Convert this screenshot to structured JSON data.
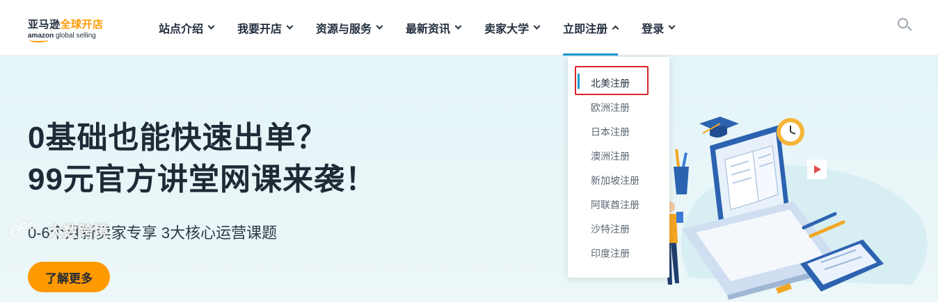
{
  "logo": {
    "cn_part1": "亚马逊",
    "cn_part2": "全球开店",
    "en_part1": "amazon",
    "en_part2": " global selling"
  },
  "nav": {
    "items": [
      {
        "label": "站点介绍",
        "expanded": false
      },
      {
        "label": "我要开店",
        "expanded": false
      },
      {
        "label": "资源与服务",
        "expanded": false
      },
      {
        "label": "最新资讯",
        "expanded": false
      },
      {
        "label": "卖家大学",
        "expanded": false
      },
      {
        "label": "立即注册",
        "expanded": true
      },
      {
        "label": "登录",
        "expanded": false
      }
    ]
  },
  "dropdown": {
    "items": [
      "北美注册",
      "欧洲注册",
      "日本注册",
      "澳洲注册",
      "新加坡注册",
      "阿联酋注册",
      "沙特注册",
      "印度注册"
    ],
    "highlighted_index": 0
  },
  "hero": {
    "headline_line1": "0基础也能快速出单？",
    "headline_line2": "99元官方讲堂网课来袭！",
    "subtitle": "0-6个月新卖家专享 3大核心运营课题",
    "cta_label": "了解更多"
  },
  "watermark": {
    "text": "大数跨境"
  },
  "colors": {
    "brand_orange": "#ff9900",
    "accent_blue": "#1a98cf",
    "dark_text": "#232f3e",
    "hero_bg": "#e6f5f8",
    "highlight_red": "#d9252a"
  }
}
